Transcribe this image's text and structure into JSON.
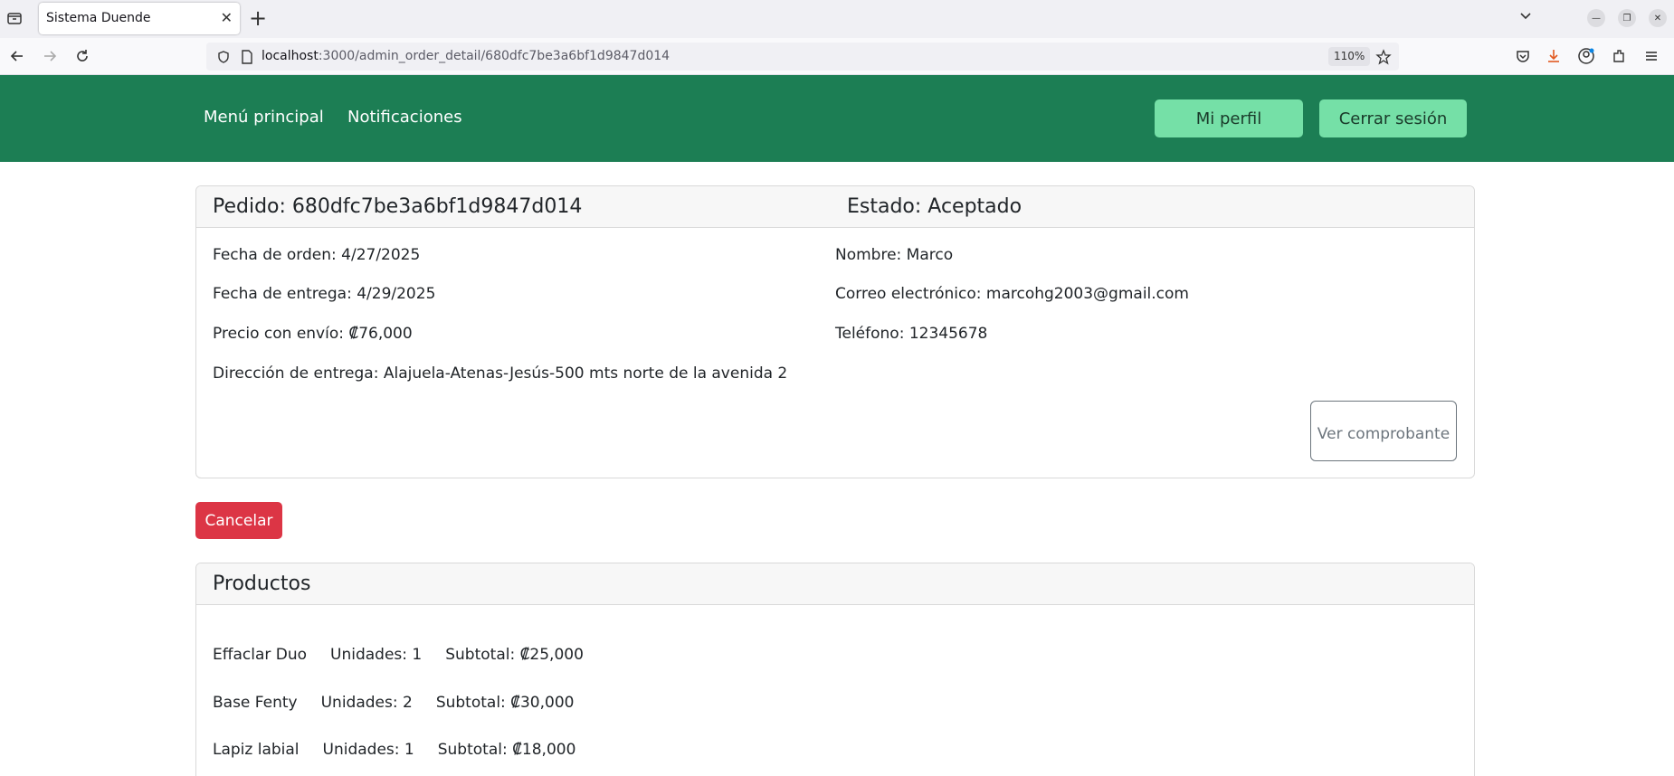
{
  "browser": {
    "tab_title": "Sistema Duende",
    "url_host": "localhost",
    "url_rest": ":3000/admin_order_detail/680dfc7be3a6bf1d9847d014",
    "zoom": "110%"
  },
  "header": {
    "nav": [
      "Menú principal",
      "Notificaciones"
    ],
    "profile_label": "Mi perfil",
    "logout_label": "Cerrar sesión",
    "bg_color": "#1c7e54",
    "button_color": "#75e0a7"
  },
  "order": {
    "title": "Pedido: 680dfc7be3a6bf1d9847d014",
    "status": "Estado: Aceptado",
    "order_date": "Fecha de orden: 4/27/2025",
    "delivery_date": "Fecha de entrega: 4/29/2025",
    "price": "Precio con envío: ₡76,000",
    "address": "Dirección de entrega: Alajuela-Atenas-Jesús-500 mts norte de la avenida 2",
    "name": "Nombre: Marco",
    "email": "Correo electrónico: marcohg2003@gmail.com",
    "phone": "Teléfono: 12345678",
    "receipt_label": "Ver comprobante",
    "cancel_label": "Cancelar"
  },
  "products": {
    "title": "Productos",
    "items": [
      {
        "name": "Effaclar Duo",
        "units": "Unidades: 1",
        "subtotal": "Subtotal: ₡25,000"
      },
      {
        "name": "Base Fenty",
        "units": "Unidades: 2",
        "subtotal": "Subtotal: ₡30,000"
      },
      {
        "name": "Lapiz labial",
        "units": "Unidades: 1",
        "subtotal": "Subtotal: ₡18,000"
      }
    ]
  }
}
